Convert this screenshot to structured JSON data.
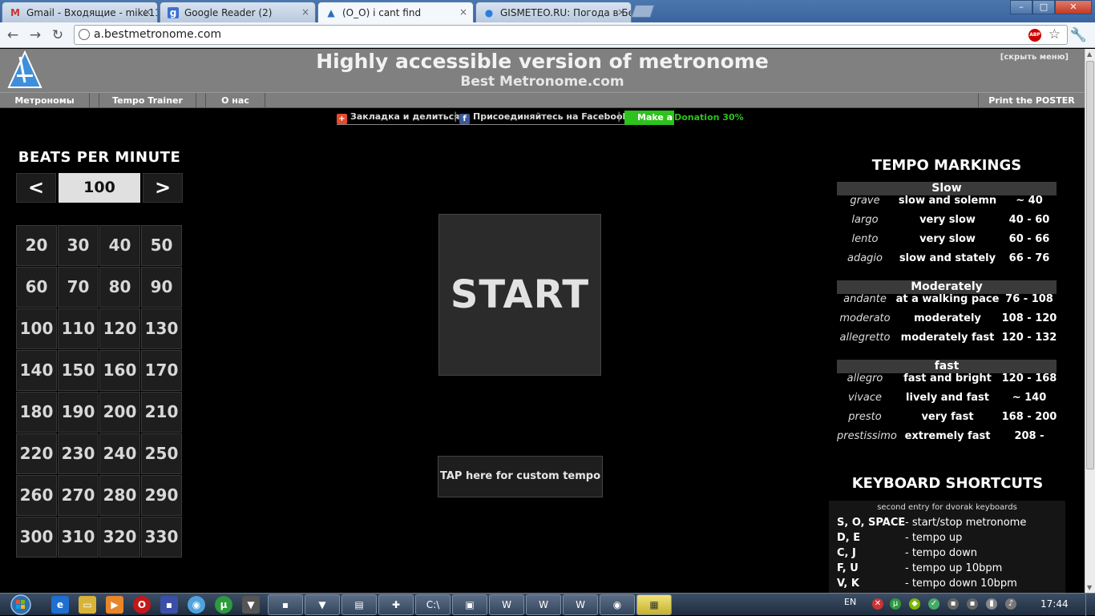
{
  "browser": {
    "tabs": [
      {
        "title": "Gmail - Входящие - mike11",
        "icon": "gmail-icon"
      },
      {
        "title": "Google Reader (2)",
        "icon": "google-reader-icon"
      },
      {
        "title": "(O_O) i cant find",
        "icon": "metronome-icon"
      },
      {
        "title": "GISMETEO.RU: Погода в Бе",
        "icon": "gismeteo-icon"
      }
    ],
    "tab_close": "×",
    "url": "a.bestmetronome.com",
    "abp_label": "ABP"
  },
  "header": {
    "title": "Highly accessible version of metronome",
    "subtitle": "Best Metronome.com",
    "hide_menu": "[скрыть меню]"
  },
  "menu": {
    "items": [
      "Метрономы",
      "Tempo Trainer",
      "О нас"
    ],
    "poster": "Print the POSTER"
  },
  "social": {
    "bookmark": "Закладка и делиться",
    "facebook": "Присоединяйтесь на Facebook",
    "donate_make": "Make a",
    "donate_rest": "Donation 30%",
    "separator": "|"
  },
  "bpm": {
    "title": "BEATS PER MINUTE",
    "dec": "<",
    "inc": ">",
    "value": "100",
    "presets": [
      "20",
      "30",
      "40",
      "50",
      "60",
      "70",
      "80",
      "90",
      "100",
      "110",
      "120",
      "130",
      "140",
      "150",
      "160",
      "170",
      "180",
      "190",
      "200",
      "210",
      "220",
      "230",
      "240",
      "250",
      "260",
      "270",
      "280",
      "290",
      "300",
      "310",
      "320",
      "330"
    ]
  },
  "start_label": "START",
  "tap_label": "TAP here for custom tempo",
  "tempo": {
    "title": "TEMPO MARKINGS",
    "groups": [
      {
        "name": "Slow",
        "rows": [
          {
            "term": "grave",
            "desc": "slow and solemn",
            "range": "~ 40"
          },
          {
            "term": "largo",
            "desc": "very slow",
            "range": "40 - 60"
          },
          {
            "term": "lento",
            "desc": "very slow",
            "range": "60 - 66"
          },
          {
            "term": "adagio",
            "desc": "slow and stately",
            "range": "66 - 76"
          }
        ]
      },
      {
        "name": "Moderately",
        "rows": [
          {
            "term": "andante",
            "desc": "at a walking pace",
            "range": "76 - 108"
          },
          {
            "term": "moderato",
            "desc": "moderately",
            "range": "108 - 120"
          },
          {
            "term": "allegretto",
            "desc": "moderately fast",
            "range": "120 - 132"
          }
        ]
      },
      {
        "name": "fast",
        "rows": [
          {
            "term": "allegro",
            "desc": "fast and bright",
            "range": "120 - 168"
          },
          {
            "term": "vivace",
            "desc": "lively and fast",
            "range": "~ 140"
          },
          {
            "term": "presto",
            "desc": "very fast",
            "range": "168 - 200"
          },
          {
            "term": "prestissimo",
            "desc": "extremely fast",
            "range": "208 -"
          }
        ]
      }
    ]
  },
  "keyboard": {
    "title": "KEYBOARD SHORTCUTS",
    "note": "second entry for dvorak keyboards",
    "rows": [
      {
        "keys": "S, O, SPACE",
        "desc": "- start/stop metronome"
      },
      {
        "keys": "D, E",
        "desc": "- tempo up"
      },
      {
        "keys": "C, J",
        "desc": "- tempo down"
      },
      {
        "keys": "F, U",
        "desc": "- tempo up 10bpm"
      },
      {
        "keys": "V, K",
        "desc": "- tempo down 10bpm"
      }
    ]
  },
  "taskbar": {
    "lang": "EN",
    "clock": "17:44"
  },
  "colors": {
    "header_bg": "#808080",
    "donate_green": "#2ec21c",
    "page_bg": "#000000"
  }
}
